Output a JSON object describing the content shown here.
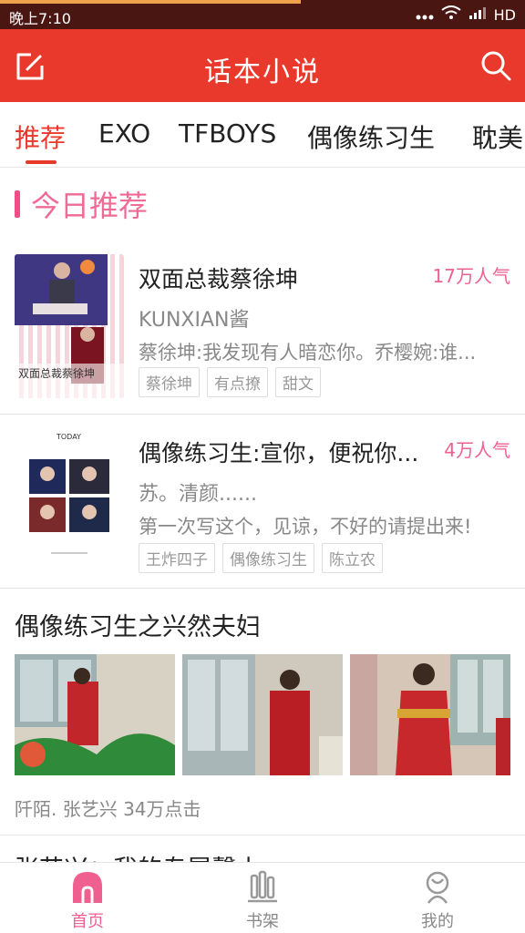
{
  "status_bar": {
    "time": "晚上7:10",
    "network": "HD",
    "icons": [
      "more-dots-icon",
      "wifi-icon",
      "signal-icon"
    ]
  },
  "app_bar": {
    "title": "话本小说",
    "left_icon": "edit-icon",
    "right_icon": "search-icon",
    "color": "#e8392c"
  },
  "tabs": [
    {
      "label": "推荐",
      "active": true
    },
    {
      "label": "EXO",
      "active": false
    },
    {
      "label": "TFBOYS",
      "active": false
    },
    {
      "label": "偶像练习生",
      "active": false
    },
    {
      "label": "耽美",
      "active": false
    }
  ],
  "section": {
    "title": "今日推荐",
    "accent": "#ef4f86"
  },
  "books": [
    {
      "title": "双面总裁蔡徐坤",
      "popularity": "17万人气",
      "author": "KUNXIAN酱",
      "description": "蔡徐坤:我发现有人暗恋你。乔樱婉:谁...",
      "tags": [
        "蔡徐坤",
        "有点撩",
        "甜文"
      ],
      "cover_text": "双面总裁蔡徐坤"
    },
    {
      "title": "偶像练习生:宣你，便祝你...",
      "popularity": "4万人气",
      "author": "苏。清颜......",
      "description": "第一次写这个，见谅，不好的请提出来!",
      "tags": [
        "王炸四子",
        "偶像练习生",
        "陈立农"
      ],
      "cover_text": "TODAY"
    }
  ],
  "post": {
    "title": "偶像练习生之兴然夫妇",
    "meta": "阡陌.  张艺兴    34万点击"
  },
  "next_post": {
    "title": "张艺兴：我的专属馨小"
  },
  "bottom_nav": [
    {
      "label": "首页",
      "icon": "home-icon",
      "active": true
    },
    {
      "label": "书架",
      "icon": "bookshelf-icon",
      "active": false
    },
    {
      "label": "我的",
      "icon": "profile-icon",
      "active": false
    }
  ]
}
